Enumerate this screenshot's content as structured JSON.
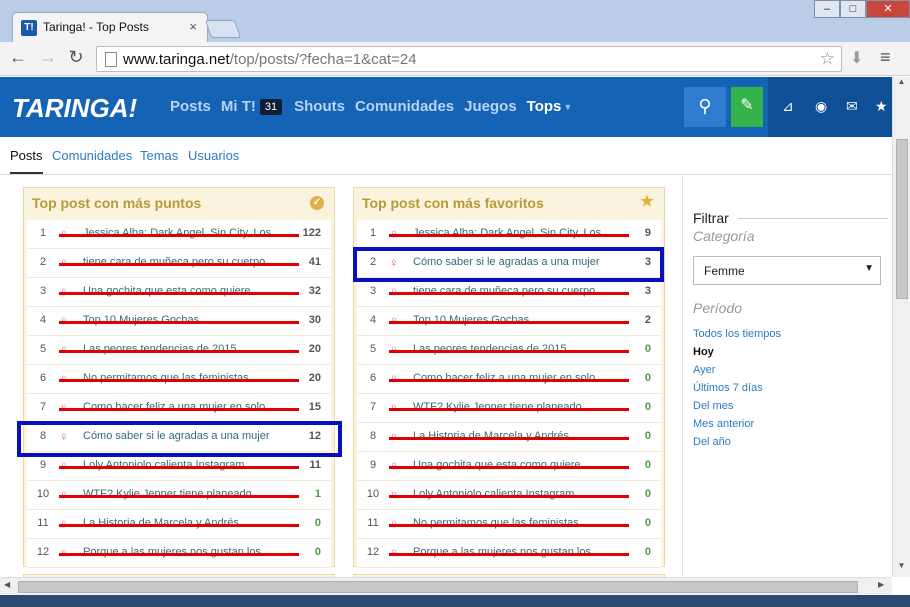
{
  "browser": {
    "tab_title": "Taringa! - Top Posts",
    "tab_favicon": "T!",
    "url_host": "www.taringa.net",
    "url_path": "/top/posts/?fecha=1&cat=24"
  },
  "site": {
    "logo": "TARINGA!",
    "nav": [
      {
        "label": "Posts"
      },
      {
        "label": "Mi T!"
      },
      {
        "label": "Shouts"
      },
      {
        "label": "Comunidades"
      },
      {
        "label": "Juegos"
      },
      {
        "label": "Tops"
      }
    ],
    "mi_badge": "31",
    "header_icons": [
      "search-icon",
      "new-post-icon",
      "stats-icon",
      "eye-icon",
      "mail-icon",
      "star-icon"
    ]
  },
  "subnav": [
    "Posts",
    "Comunidades",
    "Temas",
    "Usuarios"
  ],
  "panel_points": {
    "title": "Top post con más puntos",
    "rows": [
      {
        "rank": "1",
        "title": "Jessica Alba: Dark Angel, Sin City, Los",
        "count": "122",
        "struck": true
      },
      {
        "rank": "2",
        "title": "tiene cara de muñeca pero su cuerpo",
        "count": "41",
        "struck": true
      },
      {
        "rank": "3",
        "title": "Una gochita que esta como quiere.",
        "count": "32",
        "struck": true
      },
      {
        "rank": "4",
        "title": "Top 10 Mujeres Gochas.",
        "count": "30",
        "struck": true
      },
      {
        "rank": "5",
        "title": "Las peores tendencias de 2015",
        "count": "20",
        "struck": true
      },
      {
        "rank": "6",
        "title": "No permitamos que las feministas",
        "count": "20",
        "struck": true
      },
      {
        "rank": "7",
        "title": "Como hacer feliz a una mujer en solo",
        "count": "15",
        "struck": true
      },
      {
        "rank": "8",
        "title": "Cómo saber si le agradas a una mujer",
        "count": "12",
        "struck": false
      },
      {
        "rank": "9",
        "title": "Loly Antoniolo calienta Instagram",
        "count": "11",
        "struck": true
      },
      {
        "rank": "10",
        "title": "WTF? Kylie Jenner tiene planeado",
        "count": "1",
        "struck": true
      },
      {
        "rank": "11",
        "title": "La Historia de Marcela y Andrés",
        "count": "0",
        "struck": true
      },
      {
        "rank": "12",
        "title": "Porque a las mujeres nos gustan los",
        "count": "0",
        "struck": true
      }
    ]
  },
  "panel_favs": {
    "title": "Top post con más favoritos",
    "rows": [
      {
        "rank": "1",
        "title": "Jessica Alba: Dark Angel, Sin City, Los",
        "count": "9",
        "struck": true
      },
      {
        "rank": "2",
        "title": "Cómo saber si le agradas a una mujer",
        "count": "3",
        "struck": false
      },
      {
        "rank": "3",
        "title": "tiene cara de muñeca pero su cuerpo",
        "count": "3",
        "struck": true
      },
      {
        "rank": "4",
        "title": "Top 10 Mujeres Gochas.",
        "count": "2",
        "struck": true
      },
      {
        "rank": "5",
        "title": "Las peores tendencias de 2015",
        "count": "0",
        "struck": true
      },
      {
        "rank": "6",
        "title": "Como hacer feliz a una mujer en solo",
        "count": "0",
        "struck": true
      },
      {
        "rank": "7",
        "title": "WTF? Kylie Jenner tiene planeado",
        "count": "0",
        "struck": true
      },
      {
        "rank": "8",
        "title": "La Historia de Marcela y Andrés",
        "count": "0",
        "struck": true
      },
      {
        "rank": "9",
        "title": "Una gochita que esta como quiere.",
        "count": "0",
        "struck": true
      },
      {
        "rank": "10",
        "title": "Loly Antoniolo calienta Instagram",
        "count": "0",
        "struck": true
      },
      {
        "rank": "11",
        "title": "No permitamos que las feministas",
        "count": "0",
        "struck": true
      },
      {
        "rank": "12",
        "title": "Porque a las mujeres nos gustan los",
        "count": "0",
        "struck": true
      }
    ]
  },
  "filter": {
    "title": "Filtrar",
    "category_label": "Categoría",
    "category_value": "Femme",
    "period_label": "Período",
    "periods": [
      "Todos los tiempos",
      "Hoy",
      "Ayer",
      "Últimos 7 días",
      "Del mes",
      "Mes anterior",
      "Del año"
    ],
    "active_period": "Hoy"
  },
  "colors": {
    "header_blue": "#1563b4",
    "strike_red": "#e00000",
    "highlight_blue": "#0610c0",
    "panel_bg": "#faf3dd"
  }
}
